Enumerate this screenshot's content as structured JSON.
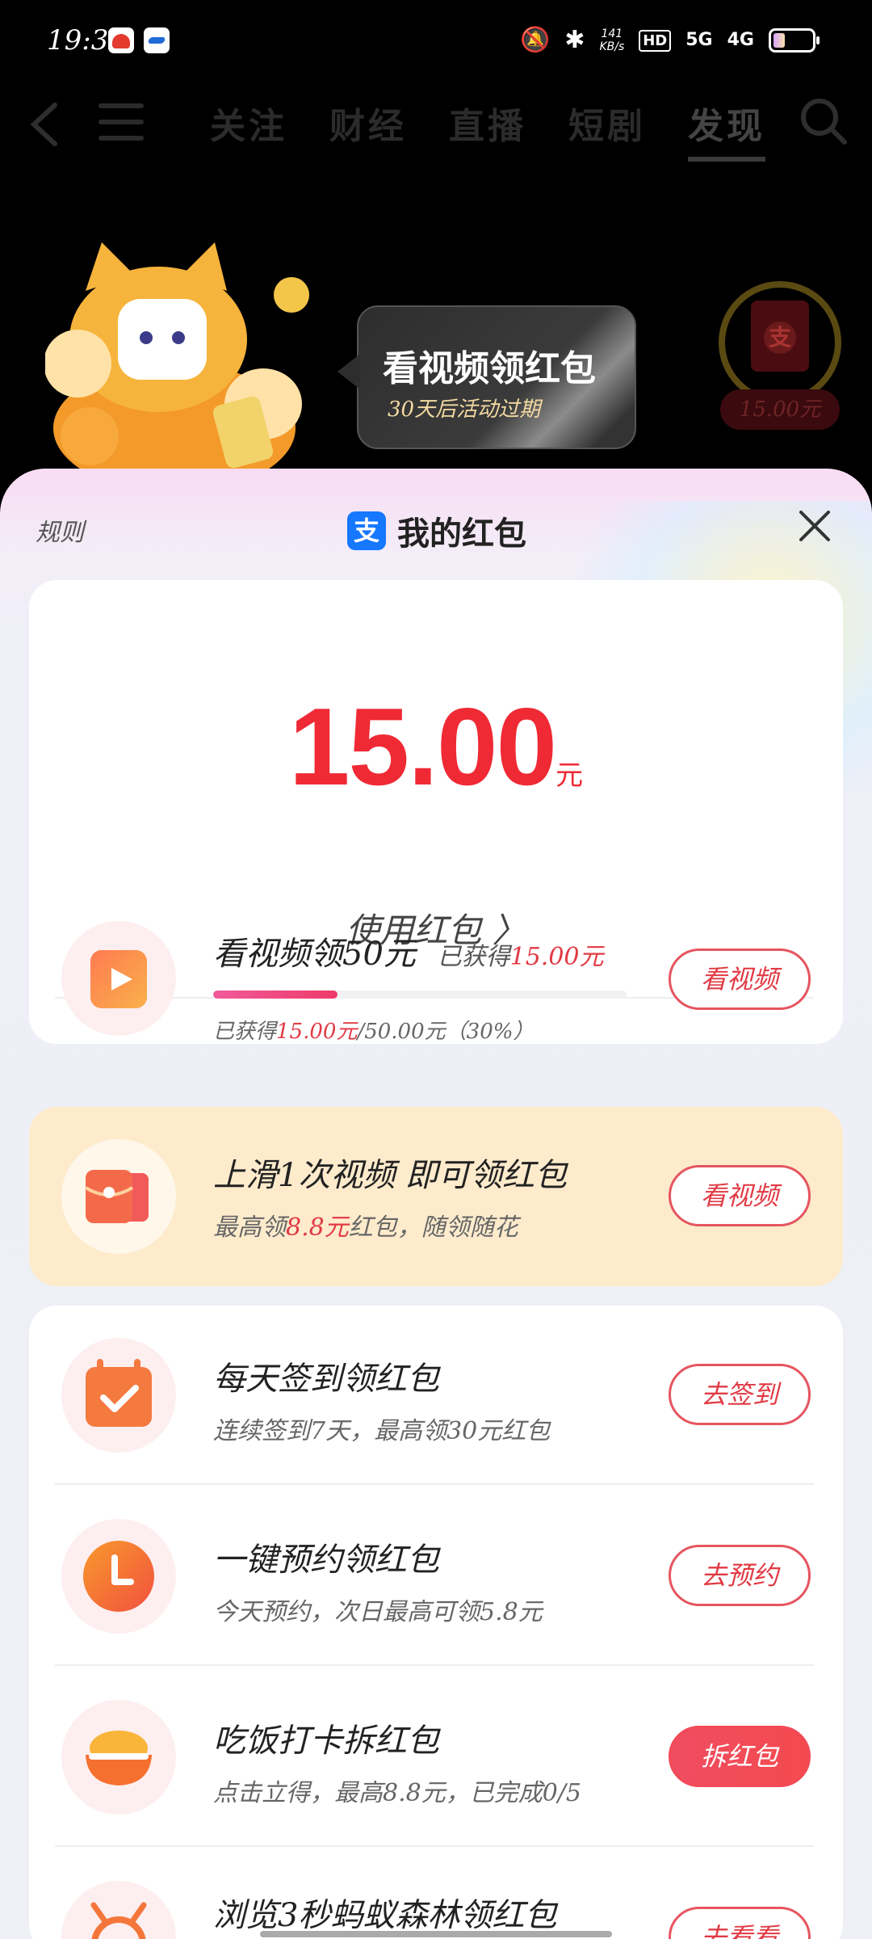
{
  "status_bar": {
    "time": "19:39",
    "speed_top": "141",
    "speed_bottom": "KB/s",
    "hd": "HD",
    "net1": "5G",
    "net2": "4G",
    "battery_level": 0.3
  },
  "top_nav": {
    "tabs": [
      "关注",
      "财经",
      "直播",
      "短剧",
      "发现"
    ],
    "active_tab": "发现"
  },
  "promo": {
    "bubble_title": "看视频领红包",
    "bubble_subtitle": "30天后活动过期",
    "ring_badge_icon": "支",
    "ring_amount": "15.00元"
  },
  "sheet": {
    "rules_label": "规则",
    "logo_glyph": "支",
    "title": "我的红包",
    "balance": "15.00",
    "balance_unit": "元",
    "use_link": "使用红包 〉",
    "tasks": [
      {
        "title": "看视频领50元",
        "earned_prefix": "已获得",
        "earned_value": "15.00元",
        "progress_prefix": "已获得",
        "progress_value": "15.00元",
        "progress_suffix": "/50.00元（30%）",
        "progress_fraction": 0.3,
        "button": "看视频",
        "icon": "play-video-icon"
      },
      {
        "title": "上滑1次视频 即可领红包",
        "sub_prefix": "最高领",
        "sub_value": "8.8元",
        "sub_suffix": "红包，随领随花",
        "button": "看视频",
        "icon": "red-envelope-icon"
      },
      {
        "title": "每天签到领红包",
        "sub": "连续签到7天，最高领30元红包",
        "button": "去签到",
        "icon": "calendar-check-icon"
      },
      {
        "title": "一键预约领红包",
        "sub": "今天预约，次日最高可领5.8元",
        "button": "去预约",
        "icon": "clock-icon"
      },
      {
        "title": "吃饭打卡拆红包",
        "sub": "点击立得，最高8.8元，已完成0/5",
        "button": "拆红包",
        "icon": "rice-bowl-icon"
      },
      {
        "title": "浏览3秒蚂蚁森林领红包",
        "button": "去看看",
        "icon": "ant-icon"
      }
    ]
  },
  "colors": {
    "accent_red": "#ef2a35",
    "alipay_blue": "#1677ff",
    "highlight_card": "#fdebcc"
  }
}
